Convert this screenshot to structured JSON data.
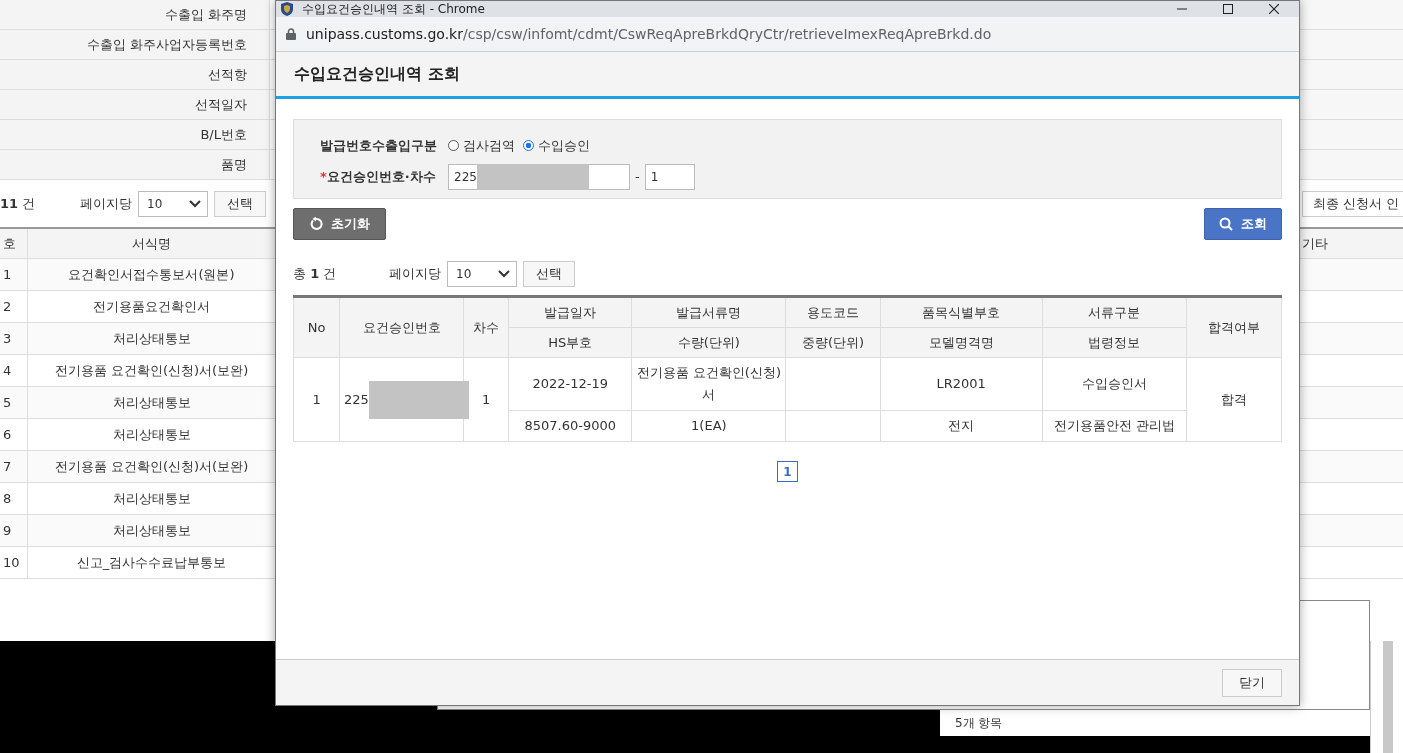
{
  "background_page": {
    "info_rows": [
      {
        "label": "수출입 화주명"
      },
      {
        "label": "수출입 화주사업자등록번호"
      },
      {
        "label": "선적항"
      },
      {
        "label": "선적일자"
      },
      {
        "label": "B/L번호"
      },
      {
        "label": "품명"
      }
    ],
    "total": "**11** 건",
    "per_page_label": "페이지당",
    "per_page": "10",
    "select_button": "선택",
    "columns": [
      "호",
      "서식명"
    ],
    "rows": [
      {
        "no": "1",
        "name": "요건확인서접수통보서(원본)"
      },
      {
        "no": "2",
        "name": "전기용품요건확인서"
      },
      {
        "no": "3",
        "name": "처리상태통보"
      },
      {
        "no": "4",
        "name": "전기용품 요건확인(신청)서(보완)"
      },
      {
        "no": "5",
        "name": "처리상태통보"
      },
      {
        "no": "6",
        "name": "처리상태통보"
      },
      {
        "no": "7",
        "name": "전기용품 요건확인(신청)서(보완)"
      },
      {
        "no": "8",
        "name": "처리상태통보"
      },
      {
        "no": "9",
        "name": "처리상태통보"
      },
      {
        "no": "10",
        "name": "신고_검사수수료납부통보"
      }
    ],
    "print_button": "최종 신청서 인",
    "right_column": "기타"
  },
  "explorer": {
    "status": "5개 항목"
  },
  "popup": {
    "window_title": "수입요건승인내역 조회 - Chrome",
    "url_host": "unipass.customs.go.kr",
    "url_path": "/csp/csw/infomt/cdmt/CswReqApreBrkdQryCtr/retrieveImexReqApreBrkd.do",
    "header": "수입요건승인내역 조회",
    "search": {
      "type_label": "발급번호수출입구분",
      "options": [
        {
          "label": "검사검역",
          "selected": false
        },
        {
          "label": "수입승인",
          "selected": true
        }
      ],
      "required_mark": "*",
      "number_label": "요건승인번호·차수",
      "number_value": "225",
      "separator": "-",
      "sequence_value": "1"
    },
    "reset_button": "초기화",
    "search_button": "조회",
    "total": "총 **1** 건",
    "per_page_label": "페이지당",
    "per_page": "10",
    "select_button": "선택",
    "table": {
      "header": [
        {
          "top": "No"
        },
        {
          "top": "요건승인번호"
        },
        {
          "top": "차수"
        },
        {
          "top": "발급일자",
          "bottom": "HS부호"
        },
        {
          "top": "발급서류명",
          "bottom": "수량(단위)"
        },
        {
          "top": "용도코드",
          "bottom": "중량(단위)"
        },
        {
          "top": "품목식별부호",
          "bottom": "모델명격명"
        },
        {
          "top": "서류구분",
          "bottom": "법령정보"
        },
        {
          "top": "합격여부"
        }
      ],
      "rows": [
        {
          "no": "1",
          "number": "225",
          "sequence": "1",
          "lines": [
            {
              "issue_date": "2022-12-19",
              "document_name": "전기용품 요건확인(신청)서",
              "item_id": "LR2001",
              "document_type": "수입승인서"
            },
            {
              "hs_code": "8507.60-9000",
              "quantity": "1(EA)",
              "model": "전지",
              "law": "전기용품안전 관리법"
            }
          ],
          "result": "합격"
        }
      ]
    },
    "pages": [
      {
        "label": "1",
        "selected": true
      }
    ],
    "close_button": "닫기"
  }
}
